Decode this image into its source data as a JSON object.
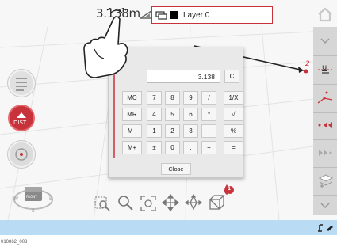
{
  "topbar": {
    "distance": "3.138m",
    "layer_name": "Layer 0"
  },
  "leftpanel": {
    "dist_label": "DIST"
  },
  "compass": {
    "west": "W",
    "east": "E",
    "south": "S",
    "front": "FRONT"
  },
  "rightbar": {
    "item_u_label": "u"
  },
  "calculator": {
    "display": "3.138",
    "clear_label": "C",
    "keys": [
      [
        "MC",
        "7",
        "8",
        "9",
        "/",
        "1/X"
      ],
      [
        "MR",
        "4",
        "5",
        "6",
        "*",
        "√"
      ],
      [
        "M−",
        "1",
        "2",
        "3",
        "−",
        "%"
      ],
      [
        "M+",
        "±",
        "0",
        ".",
        "+",
        "="
      ]
    ],
    "close_label": "Close"
  },
  "drawing": {
    "point_label": "2",
    "bubble_label": "1"
  },
  "caption": "010862_003",
  "colors": {
    "accent": "#c8323a",
    "statusbar": "#b9dbf3",
    "sidebar": "#d6d6d6"
  }
}
